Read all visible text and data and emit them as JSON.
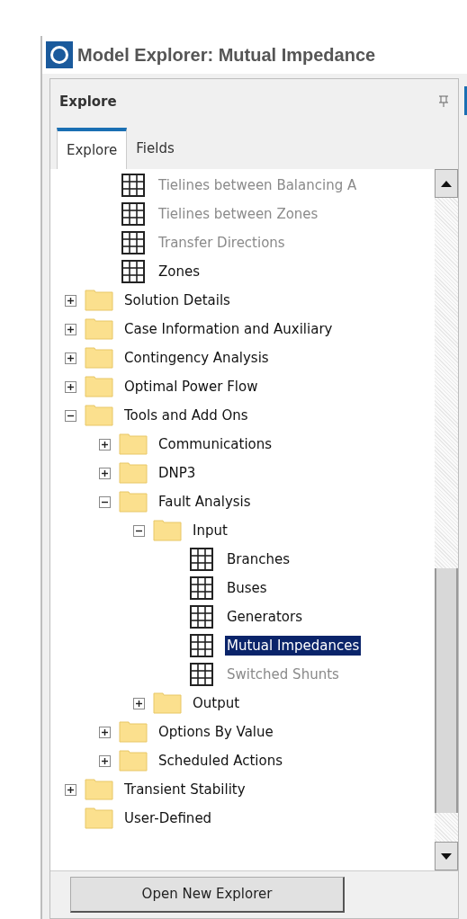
{
  "window": {
    "title": "Model Explorer: Mutual Impedance"
  },
  "panel": {
    "title": "Explore"
  },
  "tabs": [
    {
      "label": "Explore",
      "selected": true
    },
    {
      "label": "Fields",
      "selected": false
    }
  ],
  "tree": [
    {
      "children": [
        {
          "kind": "table",
          "label": "Tielines between Balancing A",
          "disabled": true,
          "selected": false
        },
        {
          "kind": "table",
          "label": "Tielines between Zones",
          "disabled": true,
          "selected": false
        },
        {
          "kind": "table",
          "label": "Transfer Directions",
          "disabled": true,
          "selected": false
        },
        {
          "kind": "table",
          "label": "Zones",
          "disabled": false,
          "selected": false
        }
      ]
    },
    {
      "kind": "folder",
      "label": "Solution Details",
      "expanded": false
    },
    {
      "kind": "folder",
      "label": "Case Information and Auxiliary",
      "expanded": false
    },
    {
      "kind": "folder",
      "label": "Contingency Analysis",
      "expanded": false
    },
    {
      "kind": "folder",
      "label": "Optimal Power Flow",
      "expanded": false
    },
    {
      "kind": "folder",
      "label": "Tools and Add Ons",
      "expanded": true,
      "children": [
        {
          "kind": "folder",
          "label": "Communications",
          "expanded": false
        },
        {
          "kind": "folder",
          "label": "DNP3",
          "expanded": false
        },
        {
          "kind": "folder",
          "label": "Fault Analysis",
          "expanded": true,
          "children": [
            {
              "kind": "folder",
              "label": "Input",
              "expanded": true,
              "children": [
                {
                  "kind": "table",
                  "label": "Branches",
                  "disabled": false,
                  "selected": false
                },
                {
                  "kind": "table",
                  "label": "Buses",
                  "disabled": false,
                  "selected": false
                },
                {
                  "kind": "table",
                  "label": "Generators",
                  "disabled": false,
                  "selected": false
                },
                {
                  "kind": "table",
                  "label": "Mutual Impedances",
                  "disabled": false,
                  "selected": true
                },
                {
                  "kind": "table",
                  "label": "Switched Shunts",
                  "disabled": true,
                  "selected": false
                }
              ]
            },
            {
              "kind": "folder",
              "label": "Output",
              "expanded": false
            }
          ]
        },
        {
          "kind": "folder",
          "label": "Options By Value",
          "expanded": false
        },
        {
          "kind": "folder",
          "label": "Scheduled Actions",
          "expanded": false
        }
      ]
    },
    {
      "kind": "folder",
      "label": "Transient Stability",
      "expanded": false
    },
    {
      "kind": "empty-folder",
      "label": "User-Defined"
    }
  ],
  "button": {
    "label": "Open New Explorer"
  }
}
